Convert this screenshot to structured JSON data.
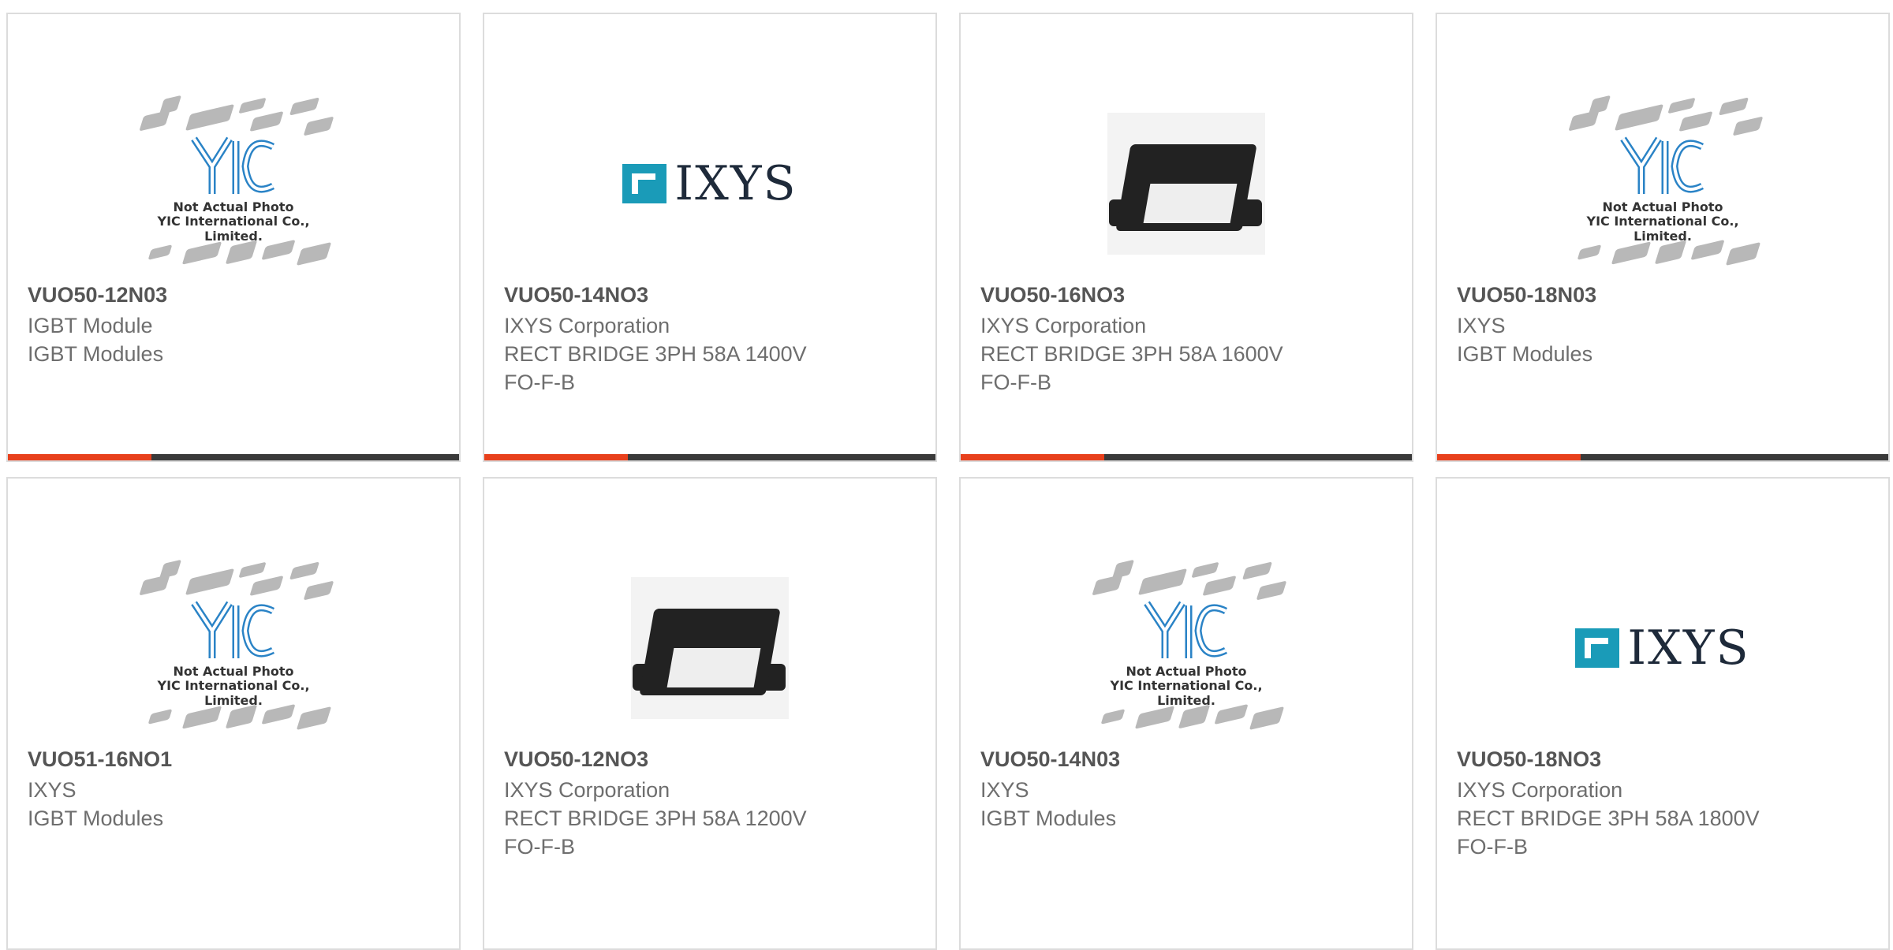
{
  "cards": [
    {
      "image": "yic-placeholder",
      "part": "VUO50-12N03",
      "lines": [
        "IGBT Module",
        "IGBT Modules"
      ]
    },
    {
      "image": "ixys-logo",
      "part": "VUO50-14NO3",
      "lines": [
        "IXYS Corporation",
        "RECT BRIDGE 3PH 58A 1400V",
        "FO-F-B"
      ]
    },
    {
      "image": "module-photo",
      "part": "VUO50-16NO3",
      "lines": [
        "IXYS Corporation",
        "RECT BRIDGE 3PH 58A 1600V",
        "FO-F-B"
      ]
    },
    {
      "image": "yic-placeholder",
      "part": "VUO50-18N03",
      "lines": [
        "IXYS",
        "IGBT Modules"
      ]
    },
    {
      "image": "yic-placeholder",
      "part": "VUO51-16NO1",
      "lines": [
        "IXYS",
        "IGBT Modules"
      ]
    },
    {
      "image": "module-photo",
      "part": "VUO50-12NO3",
      "lines": [
        "IXYS Corporation",
        "RECT BRIDGE 3PH 58A 1200V",
        "FO-F-B"
      ]
    },
    {
      "image": "yic-placeholder",
      "part": "VUO50-14N03",
      "lines": [
        "IXYS",
        "IGBT Modules"
      ]
    },
    {
      "image": "ixys-logo",
      "part": "VUO50-18NO3",
      "lines": [
        "IXYS Corporation",
        "RECT BRIDGE 3PH 58A 1800V",
        "FO-F-B"
      ]
    }
  ],
  "placeholder": {
    "line1": "Not Actual Photo",
    "line2": "YIC International Co., Limited.",
    "logo": "YIC"
  },
  "ixys_logo_text": "IXYS",
  "colors": {
    "accent": "#e8401c",
    "bar": "#3a3a3a",
    "ixys_blue": "#1a9bb8"
  }
}
